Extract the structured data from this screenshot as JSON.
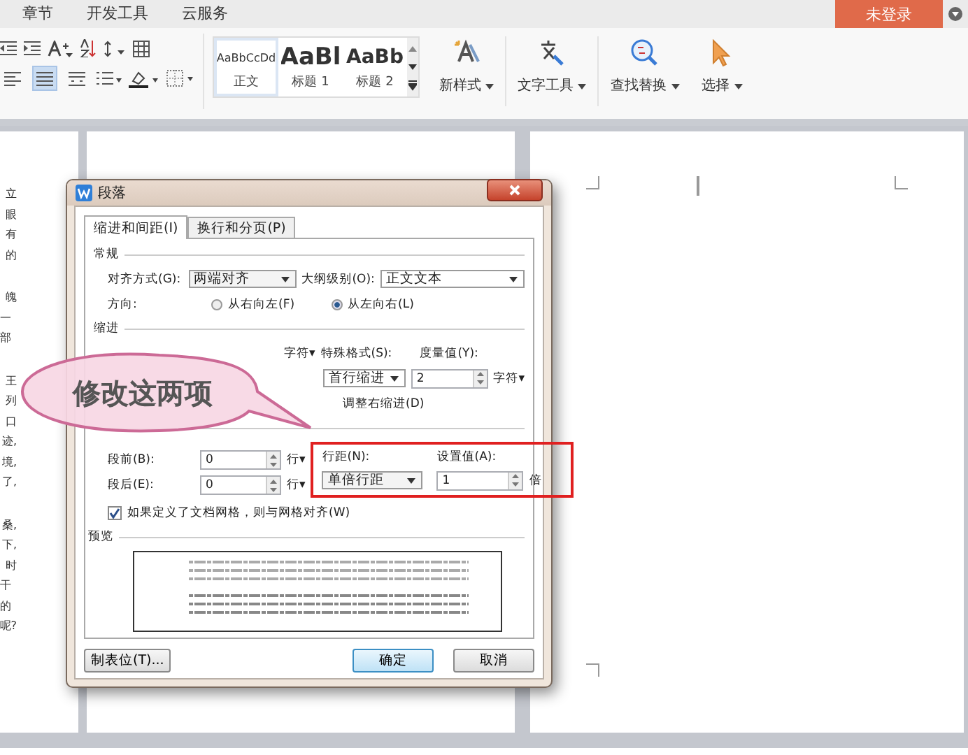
{
  "menu_tabs": [
    {
      "label": "章节"
    },
    {
      "label": "开发工具"
    },
    {
      "label": "云服务"
    }
  ],
  "login_button": "未登录",
  "ribbon": {
    "align_buttons": [
      {
        "selected": false
      },
      {
        "selected": true
      },
      {
        "selected": false
      }
    ],
    "styles": [
      {
        "sample": "AaBbCcDd",
        "name": "正文",
        "selected": true
      },
      {
        "sample": "AaBl",
        "name": "标题 1",
        "selected": false
      },
      {
        "sample": "AaBb",
        "name": "标题 2",
        "selected": false
      }
    ],
    "tools": [
      {
        "kind": "new-style",
        "label": "新样式"
      },
      {
        "kind": "text-tools",
        "label": "文字工具"
      },
      {
        "kind": "find-replace",
        "label": "查找替换"
      },
      {
        "kind": "select",
        "label": "选择"
      }
    ]
  },
  "left_page_paragraphs": [
    [
      "立",
      "眼",
      "有",
      "的"
    ],
    [
      "魄",
      "一部"
    ],
    [
      "王",
      "列",
      "口",
      "迹,",
      "境,",
      "了,"
    ],
    [
      "桑,",
      "下,",
      "时",
      "干的",
      "呢?"
    ]
  ],
  "dialog": {
    "title": "段落",
    "tabs": [
      {
        "label": "缩进和间距(I)",
        "selected": true
      },
      {
        "label": "换行和分页(P)",
        "selected": false
      }
    ],
    "general": {
      "heading": "常规",
      "alignment_label": "对齐方式(G):",
      "alignment_value": "两端对齐",
      "outline_label": "大纲级别(O):",
      "outline_value": "正文文本",
      "direction_label": "方向:",
      "direction_options": [
        {
          "label": "从右向左(F)",
          "selected": false
        },
        {
          "label": "从左向右(L)",
          "selected": true
        }
      ]
    },
    "indent": {
      "heading": "缩进",
      "before_unit": "字符▾",
      "special_label": "特殊格式(S):",
      "measure_label": "度量值(Y):",
      "special_value": "首行缩进",
      "measure_value": "2",
      "measure_unit": "字符▾",
      "auto_adjust_text": "调整右缩进(D)"
    },
    "spacing": {
      "before_label": "段前(B):",
      "before_value": "0",
      "before_unit": "行▾",
      "after_label": "段后(E):",
      "after_value": "0",
      "after_unit": "行▾",
      "line_label": "行距(N):",
      "line_value": "单倍行距",
      "set_label": "设置值(A):",
      "set_value": "1",
      "set_unit": "倍",
      "grid_checkbox": {
        "label": "如果定义了文档网格，则与网格对齐(W)",
        "checked": true
      }
    },
    "preview_heading": "预览",
    "buttons": [
      {
        "kind": "tabs",
        "label": "制表位(T)..."
      },
      {
        "kind": "ok",
        "label": "确定"
      },
      {
        "kind": "cancel",
        "label": "取消"
      }
    ]
  },
  "callout": "修改这两项"
}
